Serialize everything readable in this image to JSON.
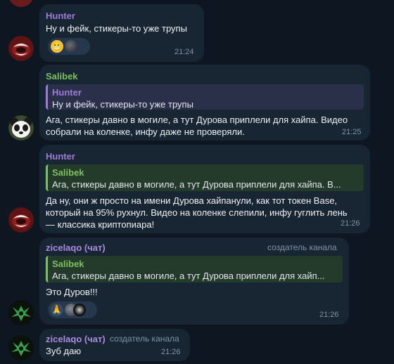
{
  "messages": [
    {
      "sender": "Hunter",
      "text": "Ну и фейк, стикеры-то уже трупы",
      "time": "21:24",
      "reactions": [
        "grimacing-face-emoji",
        "sticker-thumbnail"
      ]
    },
    {
      "sender": "Salibek",
      "reply": {
        "name": "Hunter",
        "text": "Ну и фейк, стикеры-то уже трупы"
      },
      "text_lines": [
        "Ага, стикеры давно в могиле, а тут Дурова приплели для хайпа. Видео",
        "собрали на коленке, инфу даже не проверяли."
      ],
      "time": "21:25"
    },
    {
      "sender": "Hunter",
      "reply": {
        "name": "Salibek",
        "text": "Ага, стикеры давно в могиле, а тут Дурова приплели для хайпа. В..."
      },
      "text_lines": [
        "Да ну, они ж просто на имени Дурова хайпанули, как тот токен Base,",
        "который на 95% рухнул. Видео на коленке слепили, инфу гуглить лень",
        "— классика криптопиара!"
      ],
      "time": "21:26"
    },
    {
      "sender": "zicelaqo (чат)",
      "badge": "создатель канала",
      "reply": {
        "name": "Salibek",
        "text": "Ага, стикеры давно в могиле, а тут Дурова приплели для хайп..."
      },
      "text": "Это Дуров!!!",
      "time": "21:26",
      "reactions": [
        "folded-hands-emoji",
        "sticker-thumbnail",
        "sticker-thumbnail"
      ]
    },
    {
      "sender": "zicelaqo (чат)",
      "badge": "создатель канала",
      "text": "Зуб даю",
      "time": "21:26"
    }
  ],
  "colors": {
    "background": "#0e1621",
    "bubble": "#182533",
    "hunter_name": "#9e7bd8",
    "salibek_name": "#7ec15e",
    "zicelaqo_name": "#a98be0",
    "time": "#8093a6"
  },
  "reaction_glyphs": {
    "grimacing": "😬",
    "folded_hands": "🙏"
  }
}
